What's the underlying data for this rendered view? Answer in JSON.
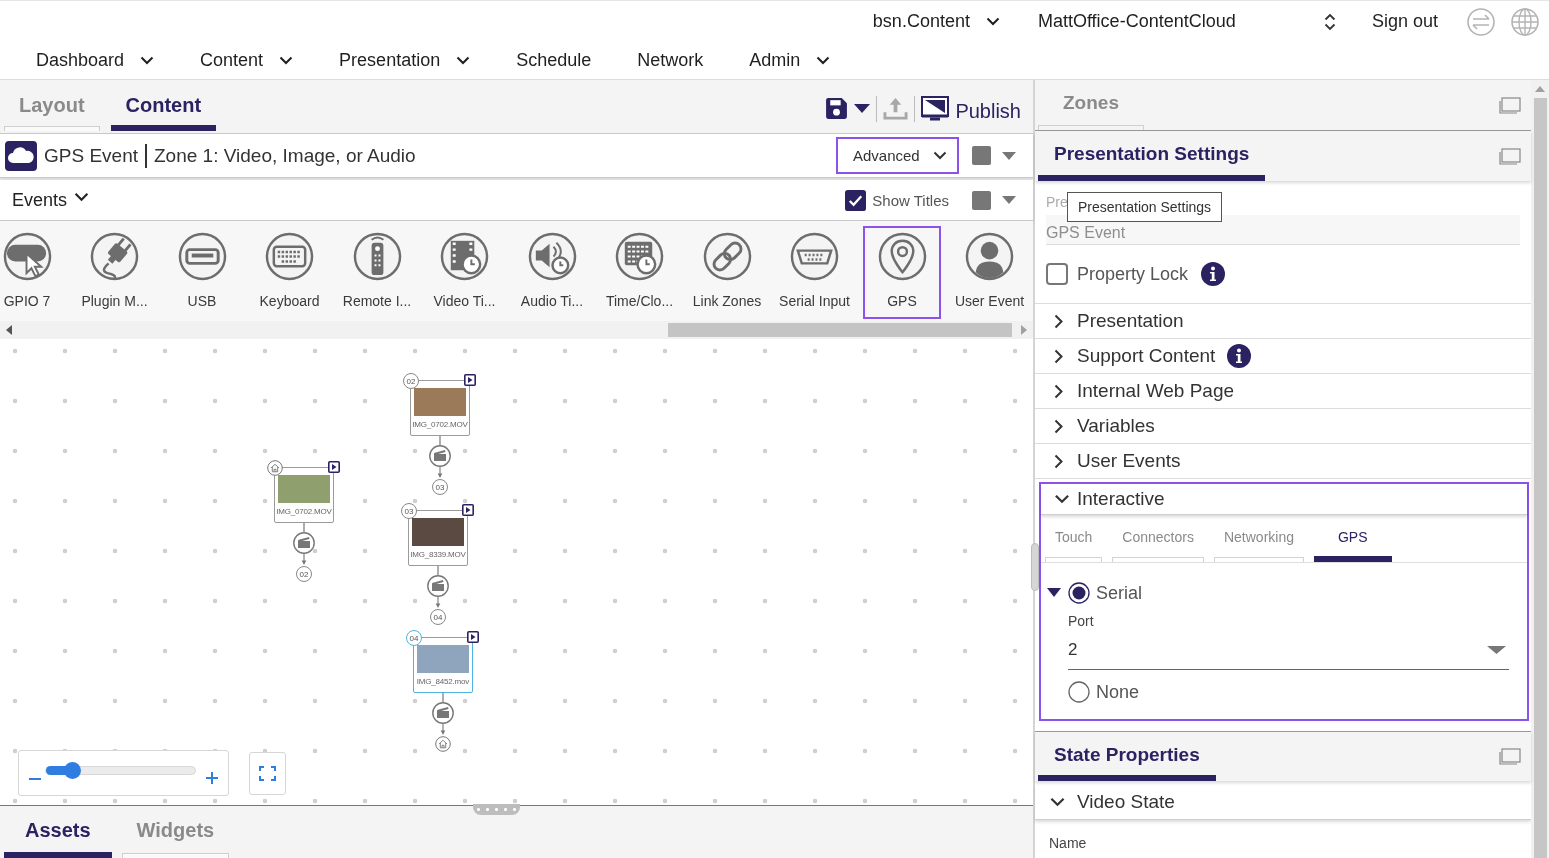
{
  "top_bar": {
    "account": "bsn.Content",
    "network": "MattOffice-ContentCloud",
    "sign_out": "Sign out"
  },
  "nav": [
    {
      "label": "Dashboard",
      "has_menu": true
    },
    {
      "label": "Content",
      "has_menu": true
    },
    {
      "label": "Presentation",
      "has_menu": true
    },
    {
      "label": "Schedule",
      "has_menu": false
    },
    {
      "label": "Network",
      "has_menu": false
    },
    {
      "label": "Admin",
      "has_menu": true
    }
  ],
  "editor": {
    "tabs": [
      {
        "label": "Layout",
        "selected": false
      },
      {
        "label": "Content",
        "selected": true
      }
    ],
    "toolbar": {
      "upload_disabled": true,
      "publish": "Publish"
    },
    "zone_header": {
      "state": "GPS Event",
      "zone": "Zone 1: Video, Image, or Audio",
      "mode": {
        "value": "Advanced",
        "highlighted": true
      }
    },
    "events_bar": {
      "label": "Events",
      "show_titles": {
        "label": "Show Titles",
        "checked": true
      }
    },
    "event_types": [
      {
        "kind": "gpio",
        "label": "GPIO 7",
        "selected": false
      },
      {
        "kind": "plugin",
        "label": "Plugin M...",
        "selected": false
      },
      {
        "kind": "usb",
        "label": "USB",
        "selected": false
      },
      {
        "kind": "keyboard",
        "label": "Keyboard",
        "selected": false
      },
      {
        "kind": "remote",
        "label": "Remote I...",
        "selected": false
      },
      {
        "kind": "video",
        "label": "Video Ti...",
        "selected": false
      },
      {
        "kind": "audio",
        "label": "Audio Ti...",
        "selected": false
      },
      {
        "kind": "time",
        "label": "Time/Clo...",
        "selected": false
      },
      {
        "kind": "link",
        "label": "Link Zones",
        "selected": false
      },
      {
        "kind": "serial",
        "label": "Serial Input",
        "selected": false
      },
      {
        "kind": "gps",
        "label": "GPS",
        "selected": true
      },
      {
        "kind": "user",
        "label": "User Event",
        "selected": false
      }
    ],
    "canvas": {
      "nodes": [
        {
          "label": "IMG_0702.MOV",
          "entry": {
            "kind": "home"
          },
          "exit": {
            "kind": "number",
            "label": "02"
          },
          "selected": false
        },
        {
          "label": "IMG_0702.MOV",
          "entry": {
            "kind": "number",
            "label": "02"
          },
          "exit": {
            "kind": "number",
            "label": "03"
          },
          "selected": false
        },
        {
          "label": "IMG_8339.MOV",
          "entry": {
            "kind": "number",
            "label": "03"
          },
          "exit": {
            "kind": "number",
            "label": "04"
          },
          "selected": false
        },
        {
          "label": "IMG_8452.mov",
          "entry": {
            "kind": "number",
            "label": "04"
          },
          "exit": {
            "kind": "home"
          },
          "selected": true
        }
      ],
      "zoom": {
        "level": 0.18
      }
    },
    "bottom_tabs": [
      {
        "label": "Assets",
        "selected": true
      },
      {
        "label": "Widgets",
        "selected": false
      }
    ]
  },
  "zones_panel": {
    "title": "Zones",
    "active": false
  },
  "presentation_settings": {
    "title": "Presentation Settings",
    "active": true,
    "name_field": {
      "label": "Pre",
      "value": "GPS Event",
      "disabled": true
    },
    "tooltip": "Presentation Settings",
    "property_lock": {
      "label": "Property Lock",
      "checked": false,
      "info": true
    },
    "sections": [
      {
        "label": "Presentation",
        "expanded": false,
        "info": false,
        "highlighted": false
      },
      {
        "label": "Support Content",
        "expanded": false,
        "info": true,
        "highlighted": false
      },
      {
        "label": "Internal Web Page",
        "expanded": false,
        "info": false,
        "highlighted": false
      },
      {
        "label": "Variables",
        "expanded": false,
        "info": false,
        "highlighted": false
      },
      {
        "label": "User Events",
        "expanded": false,
        "info": false,
        "highlighted": false
      },
      {
        "label": "Interactive",
        "expanded": true,
        "info": false,
        "highlighted": true,
        "tabs": [
          {
            "label": "Touch",
            "selected": false
          },
          {
            "label": "Connectors",
            "selected": false
          },
          {
            "label": "Networking",
            "selected": false
          },
          {
            "label": "GPS",
            "selected": true
          }
        ],
        "gps": {
          "expanded": true,
          "options": [
            {
              "label": "Serial",
              "selected": true,
              "port": {
                "label": "Port",
                "value": "2"
              }
            },
            {
              "label": "None",
              "selected": false
            }
          ]
        }
      }
    ]
  },
  "state_properties": {
    "title": "State Properties",
    "active": true,
    "section": {
      "label": "Video State",
      "expanded": true,
      "fields": [
        {
          "label": "Name"
        }
      ]
    }
  }
}
